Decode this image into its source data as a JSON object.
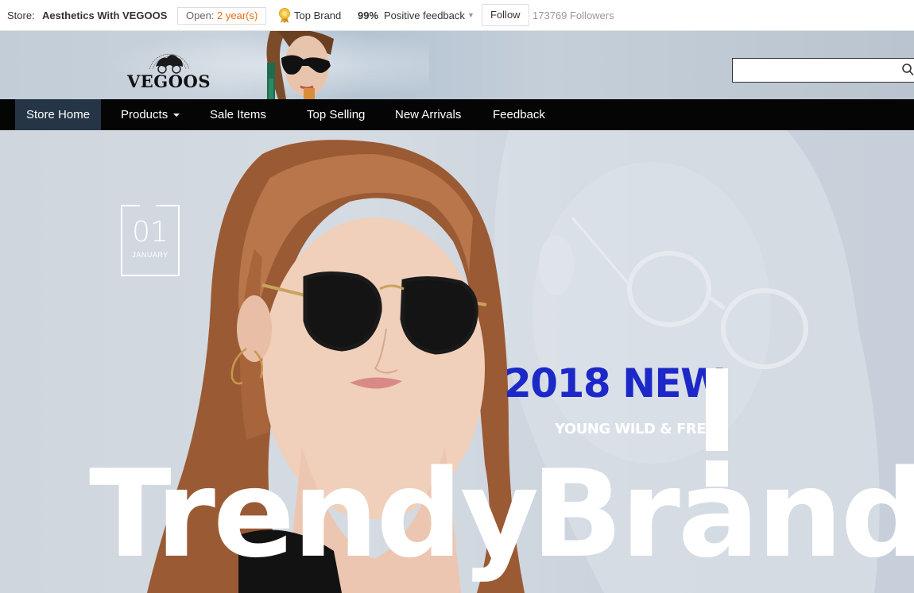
{
  "storebar": {
    "store_label": "Store:",
    "store_name": "Aesthetics With VEGOOS",
    "open_prefix": "Open:",
    "open_years": "2 year(s)",
    "badge_icon": "award-medal-icon",
    "badge_label": "Top Brand",
    "feedback_pct": "99%",
    "feedback_label": "Positive feedback",
    "follow_label": "Follow",
    "followers": "173769 Followers",
    "accent_color": "#e96b10"
  },
  "header": {
    "logo_text": "VEGOOS",
    "search_placeholder": "",
    "search_icon": "search-icon"
  },
  "nav": {
    "items": [
      {
        "label": "Store Home",
        "active": true
      },
      {
        "label": "Products",
        "dropdown": true
      },
      {
        "label": "Sale Items"
      },
      {
        "label": "Top Selling"
      },
      {
        "label": "New Arrivals"
      },
      {
        "label": "Feedback"
      }
    ],
    "active_color": "#253546"
  },
  "hero": {
    "date_day": "01",
    "date_month": "JANUARY",
    "headline": "2018 NEW",
    "tagline": "YOUNG WILD & FREE",
    "big_word_1": "Trendy",
    "big_word_2": "Brand",
    "headline_color": "#1c28c8"
  }
}
